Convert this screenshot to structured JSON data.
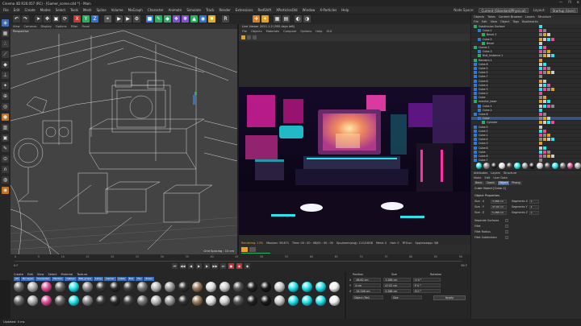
{
  "window": {
    "title": "Cinema 4D  R20.057 (RC) - [Gamer_scene.c4d *] - Main",
    "controls": [
      "—",
      "❐",
      "✕"
    ]
  },
  "menubar": {
    "items": [
      "File",
      "Edit",
      "Create",
      "Modes",
      "Select",
      "Tools",
      "Mesh",
      "Spline",
      "Volume",
      "MoGraph",
      "Character",
      "Animate",
      "Simulate",
      "Track",
      "Render",
      "Extensions",
      "RedShift",
      "XParticlesOld",
      "Window",
      "X-Particles",
      "Help"
    ],
    "node_space_label": "Node Space:",
    "node_space_value": "Current (Standard/Physical)",
    "layout_label": "Layout:",
    "layout_value": "Startup (User)"
  },
  "viewport_left": {
    "menu": [
      "View",
      "Cameras",
      "Display",
      "Options",
      "Filter",
      "Panel"
    ],
    "label": "Perspective",
    "grid_spacing": "Grid Spacing : 10 cm"
  },
  "picture_viewer": {
    "title": "Live Viewer 2021.1.2 (395 days left)",
    "menu": [
      "File",
      "Objects",
      "Materials",
      "Compare",
      "Options",
      "Help",
      "GUI"
    ],
    "status": {
      "label1": "Rendering: 13%",
      "label2": "Max/sec: 58.671",
      "label3": "Time: 00 : 00 : 08/00 : 00 : 00",
      "label4": "Gpu/mem(avg): 11G/16GB",
      "label5": "Mesh: 0",
      "label6": "Hair: 0",
      "label7": "RTX:on",
      "label8": "Spp/maxspp: 3/6"
    }
  },
  "timeline": {
    "ticks": [
      "0",
      "5",
      "10",
      "15",
      "20",
      "25",
      "30",
      "35",
      "40",
      "45",
      "50",
      "55",
      "60",
      "65",
      "70",
      "75",
      "80",
      "85",
      "90"
    ],
    "start": "0 F",
    "end": "90 F"
  },
  "material_manager": {
    "menu": [
      "Create",
      "Edit",
      "View",
      "Select",
      "Material",
      "Texture"
    ],
    "tabs": [
      "All",
      "No Layer",
      "Computer",
      "Monitor",
      "Cables",
      "Ball_props",
      "Lamp",
      "Gamer",
      "Glass",
      "Box",
      "Fan",
      "Props"
    ]
  },
  "coordinates": {
    "headers": [
      "Position",
      "Size",
      "Rotation"
    ],
    "rows": [
      {
        "axis": "X",
        "pos": "-98.62 cm",
        "size": "3.288 cm",
        "rot": "H 0 °"
      },
      {
        "axis": "Y",
        "pos": "4 cm",
        "size": "47.02 cm",
        "rot": "P 0 °"
      },
      {
        "axis": "Z",
        "pos": "-34.346 cm",
        "size": "5.288 cm",
        "rot": "B 0 °"
      }
    ],
    "mode1": "Object (Rel)",
    "mode2": "Size",
    "apply": "Apply"
  },
  "object_manager": {
    "head": [
      "Objects",
      "Takes",
      "Content Browser",
      "Layers",
      "Structure"
    ],
    "menu": [
      "File",
      "Edit",
      "View",
      "Object",
      "Tags",
      "Bookmarks"
    ],
    "rows": [
      {
        "name": "Subdivision Surface",
        "indent": 0,
        "sel": false
      },
      {
        "name": "Cube.1",
        "indent": 1,
        "sel": false
      },
      {
        "name": "Bevel.3",
        "indent": 2,
        "sel": false
      },
      {
        "name": "Cube.5",
        "indent": 1,
        "sel": false
      },
      {
        "name": "Bevel",
        "indent": 2,
        "sel": false
      },
      {
        "name": "Cloner.1",
        "indent": 0,
        "sel": false
      },
      {
        "name": "Cube.3",
        "indent": 1,
        "sel": false
      },
      {
        "name": "Null_Instance.1",
        "indent": 1,
        "sel": false
      },
      {
        "name": "Random.1",
        "indent": 0,
        "sel": false
      },
      {
        "name": "Cube.8",
        "indent": 0,
        "sel": false
      },
      {
        "name": "Cube.5",
        "indent": 0,
        "sel": false
      },
      {
        "name": "Cube.5",
        "indent": 0,
        "sel": false
      },
      {
        "name": "Cube.7",
        "indent": 0,
        "sel": false
      },
      {
        "name": "Cube.6",
        "indent": 0,
        "sel": false
      },
      {
        "name": "Cube.4",
        "indent": 0,
        "sel": false
      },
      {
        "name": "Cube.3",
        "indent": 0,
        "sel": false
      },
      {
        "name": "Cube.2",
        "indent": 0,
        "sel": false
      },
      {
        "name": "Cube",
        "indent": 0,
        "sel": false
      },
      {
        "name": "monitor_base",
        "indent": 0,
        "sel": false
      },
      {
        "name": "Cube.1",
        "indent": 1,
        "sel": false
      },
      {
        "name": "Cube.2",
        "indent": 1,
        "sel": false
      },
      {
        "name": "Cube.8",
        "indent": 0,
        "sel": false
      },
      {
        "name": "Cube",
        "indent": 1,
        "sel": true
      },
      {
        "name": "Cylinder",
        "indent": 2,
        "sel": false
      },
      {
        "name": "Cube.5",
        "indent": 0,
        "sel": false
      },
      {
        "name": "Cube.2",
        "indent": 0,
        "sel": false
      },
      {
        "name": "Cube.1",
        "indent": 0,
        "sel": false
      },
      {
        "name": "Cube.4",
        "indent": 0,
        "sel": false
      },
      {
        "name": "Cube.3",
        "indent": 0,
        "sel": false
      },
      {
        "name": "Cube.6",
        "indent": 0,
        "sel": false
      },
      {
        "name": "Cube",
        "indent": 0,
        "sel": false
      },
      {
        "name": "Cube.8",
        "indent": 0,
        "sel": false
      },
      {
        "name": "Cube.7",
        "indent": 0,
        "sel": false
      },
      {
        "name": "Cube",
        "indent": 0,
        "sel": false
      }
    ]
  },
  "attributes": {
    "tabs": [
      "Attributes",
      "Layers",
      "Structure"
    ],
    "menu": [
      "Mode",
      "Edit",
      "User Data"
    ],
    "subtabs": [
      "Basic",
      "Coord.",
      "Object",
      "Phong"
    ],
    "title": "Cube Object [Cube.1]",
    "section": "Object Properties",
    "rows": [
      {
        "label": "Size . X",
        "value": "3.288 cm",
        "label2": "Segments X",
        "value2": "1"
      },
      {
        "label": "Size . Y",
        "value": "47.02 cm",
        "label2": "Segments Y",
        "value2": "1"
      },
      {
        "label": "Size . Z",
        "value": "5.288 cm",
        "label2": "Segments Z",
        "value2": "1"
      }
    ],
    "checks": [
      "Separate Surfaces",
      "Fillet",
      "Fillet Radius",
      "Fillet Subdivision"
    ]
  },
  "statusbar": {
    "text": "Updated: 0 ms"
  },
  "colors": {
    "accent": "#f4a025",
    "cyan": "#27e6f0",
    "magenta": "#ff2fa8",
    "select": "#3b5378"
  }
}
